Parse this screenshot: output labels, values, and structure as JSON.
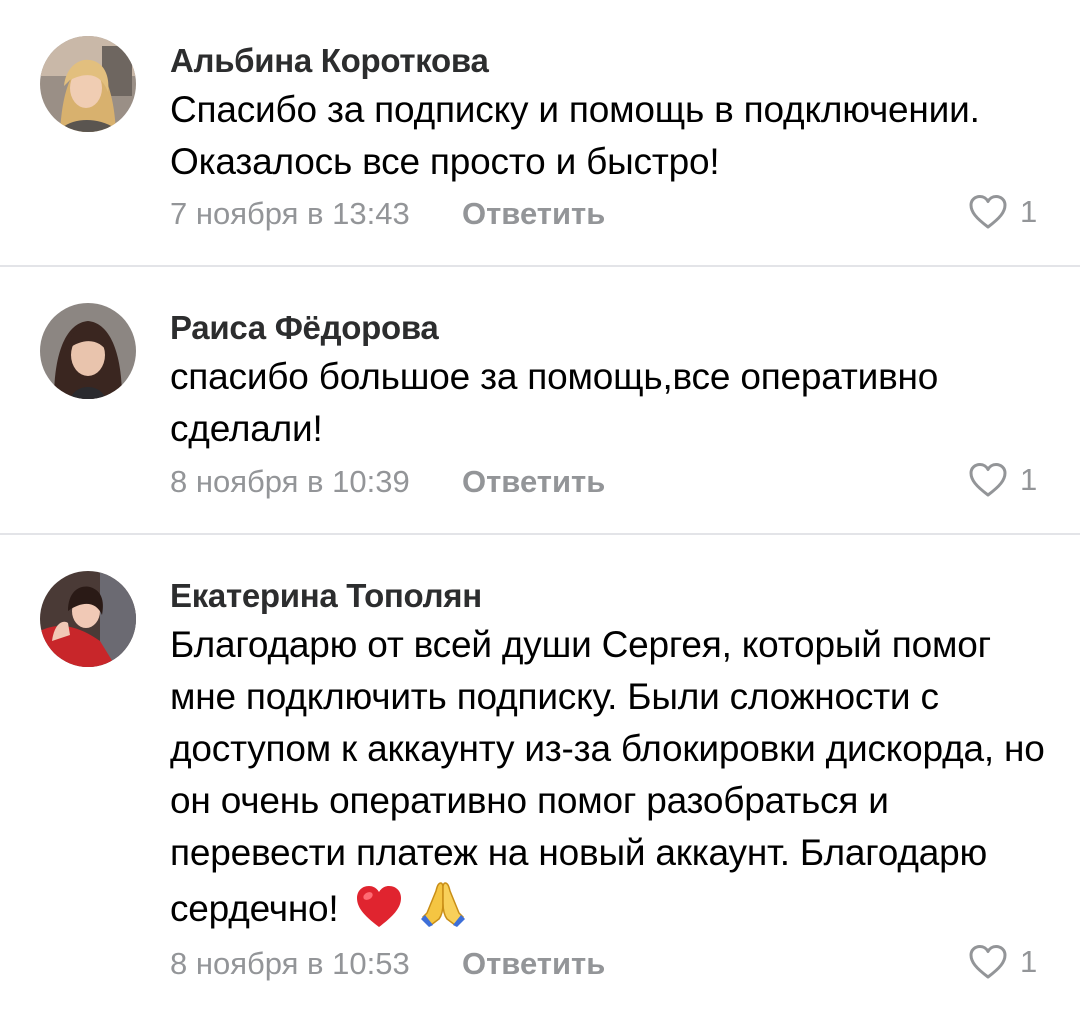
{
  "comments": [
    {
      "author": "Альбина Короткова",
      "text": "Спасибо за подписку и помощь в подключении. Оказалось все просто и быстро!",
      "date": "7 ноября в 13:43",
      "reply_label": "Ответить",
      "likes": "1",
      "avatar": "avatar-photo"
    },
    {
      "author": "Раиса Фёдорова",
      "text": "спасибо большое за помощь,все оперативно сделали!",
      "date": "8 ноября в 10:39",
      "reply_label": "Ответить",
      "likes": "1",
      "avatar": "avatar-photo"
    },
    {
      "author": "Екатерина Тополян",
      "text": "Благодарю от всей души Сергея, который помог мне подключить подписку. Были сложности с доступом к аккаунту из-за блокировки дискорда, но он очень оперативно помог разобраться и перевести платеж на новый аккаунт. Благодарю сердечно!",
      "date": "8 ноября в 10:53",
      "reply_label": "Ответить",
      "likes": "1",
      "avatar": "avatar-photo",
      "emojis": [
        "red-heart-icon",
        "praying-hands-icon"
      ]
    }
  ],
  "icons": {
    "like": "heart-outline-icon"
  },
  "colors": {
    "author": "#2c2d2e",
    "text": "#000000",
    "meta": "#939598",
    "divider": "#e3e4e8"
  }
}
